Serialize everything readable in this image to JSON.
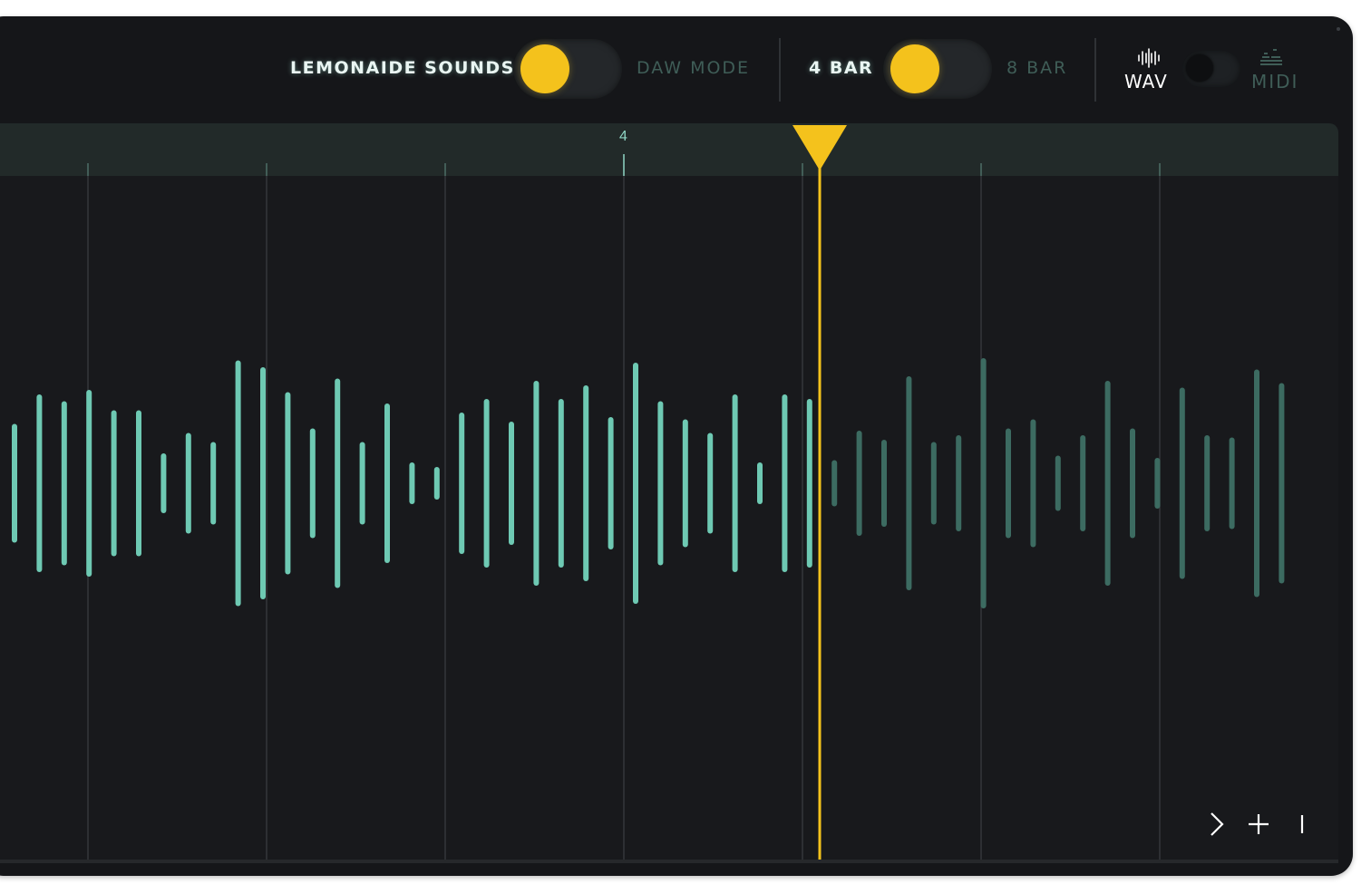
{
  "header": {
    "source_label": "LEMONAIDE SOUNDS",
    "mode_label": "DAW MODE",
    "bar_short_label": "4 BAR",
    "bar_long_label": "8 BAR",
    "wav_label": "WAV",
    "midi_label": "MIDI"
  },
  "toggles": {
    "source_mode": "LEMONAIDE SOUNDS",
    "bar_length": "4 BAR",
    "export_format": "WAV"
  },
  "ruler": {
    "marker_label": "4"
  },
  "waveform": {
    "played_color": "#6ec9b3",
    "unplayed_color": "#3c6b61",
    "playhead_color": "#f4c21c",
    "bars": [
      {
        "amp": 0.25,
        "played": true
      },
      {
        "amp": 0.38,
        "played": true
      },
      {
        "amp": 0.35,
        "played": true
      },
      {
        "amp": 0.4,
        "played": true
      },
      {
        "amp": 0.31,
        "played": true
      },
      {
        "amp": 0.31,
        "played": true
      },
      {
        "amp": 0.12,
        "played": true
      },
      {
        "amp": 0.21,
        "played": true
      },
      {
        "amp": 0.17,
        "played": true
      },
      {
        "amp": 0.53,
        "played": true
      },
      {
        "amp": 0.5,
        "played": true
      },
      {
        "amp": 0.39,
        "played": true
      },
      {
        "amp": 0.23,
        "played": true
      },
      {
        "amp": 0.45,
        "played": true
      },
      {
        "amp": 0.17,
        "played": true
      },
      {
        "amp": 0.34,
        "played": true
      },
      {
        "amp": 0.08,
        "played": true
      },
      {
        "amp": 0.06,
        "played": true
      },
      {
        "amp": 0.3,
        "played": true
      },
      {
        "amp": 0.36,
        "played": true
      },
      {
        "amp": 0.26,
        "played": true
      },
      {
        "amp": 0.44,
        "played": true
      },
      {
        "amp": 0.36,
        "played": true
      },
      {
        "amp": 0.42,
        "played": true
      },
      {
        "amp": 0.28,
        "played": true
      },
      {
        "amp": 0.52,
        "played": true
      },
      {
        "amp": 0.35,
        "played": true
      },
      {
        "amp": 0.27,
        "played": true
      },
      {
        "amp": 0.21,
        "played": true
      },
      {
        "amp": 0.38,
        "played": true
      },
      {
        "amp": 0.08,
        "played": true
      },
      {
        "amp": 0.38,
        "played": true
      },
      {
        "amp": 0.36,
        "played": true
      },
      {
        "amp": 0.09,
        "played": false
      },
      {
        "amp": 0.22,
        "played": false
      },
      {
        "amp": 0.18,
        "played": false
      },
      {
        "amp": 0.46,
        "played": false
      },
      {
        "amp": 0.17,
        "played": false
      },
      {
        "amp": 0.2,
        "played": false
      },
      {
        "amp": 0.54,
        "played": false
      },
      {
        "amp": 0.23,
        "played": false
      },
      {
        "amp": 0.27,
        "played": false
      },
      {
        "amp": 0.11,
        "played": false
      },
      {
        "amp": 0.2,
        "played": false
      },
      {
        "amp": 0.44,
        "played": false
      },
      {
        "amp": 0.23,
        "played": false
      },
      {
        "amp": 0.1,
        "played": false
      },
      {
        "amp": 0.41,
        "played": false
      },
      {
        "amp": 0.2,
        "played": false
      },
      {
        "amp": 0.19,
        "played": false
      },
      {
        "amp": 0.49,
        "played": false
      },
      {
        "amp": 0.43,
        "played": false
      }
    ]
  },
  "icons": {
    "wav": "waveform-icon",
    "midi": "midi-bars-icon",
    "next": "chevron-right-icon",
    "add": "plus-icon",
    "cursor": "cursor-line-icon"
  }
}
